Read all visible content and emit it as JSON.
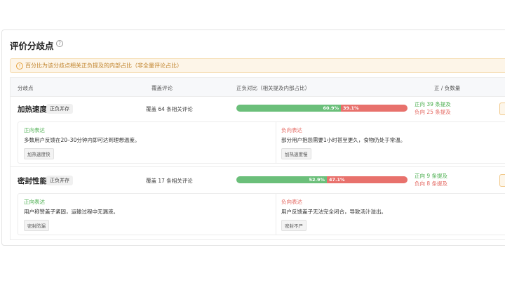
{
  "title": "评价分歧点",
  "help_glyph": "?",
  "notice": {
    "glyph": "!",
    "text": "百分比为该分歧点相关正负提及的内部占比（非全量评论占比）"
  },
  "columns": {
    "point": "分歧点",
    "coverage": "覆盖评论",
    "ratio": "正负对比（相关提及内部占比）",
    "counts": "正 / 负数量"
  },
  "rows": [
    {
      "name": "加热速度",
      "tag": "正负并存",
      "coverage": "覆盖 64 条相关评论",
      "pos_pct": 60.9,
      "pos_label": "60.9%",
      "neg_label": "39.1%",
      "pos_count": "正向 39 条提及",
      "neg_count": "负向 25 条提及",
      "positive": {
        "title": "正向表达",
        "text": "多数用户反馈在20–30分钟内即可达到理想温度。",
        "tag": "加热速度快"
      },
      "negative": {
        "title": "负向表达",
        "text": "部分用户抱怨需要1小时甚至更久，食物仍处于常温。",
        "tag": "加热速度慢"
      }
    },
    {
      "name": "密封性能",
      "tag": "正负并存",
      "coverage": "覆盖 17 条相关评论",
      "pos_pct": 52.9,
      "pos_label": "52.9%",
      "neg_label": "47.1%",
      "pos_count": "正向 9 条提及",
      "neg_count": "负向 8 条提及",
      "positive": {
        "title": "正向表达",
        "text": "用户称赞盖子紧固，运输过程中无漏液。",
        "tag": "密封防漏"
      },
      "negative": {
        "title": "负向表达",
        "text": "用户反馈盖子无法完全闭合，导致汤汁溢出。",
        "tag": "密封不严"
      }
    }
  ],
  "colors": {
    "positive": "#6bbf7a",
    "negative": "#e8716c",
    "warning": "#e6a23c"
  }
}
